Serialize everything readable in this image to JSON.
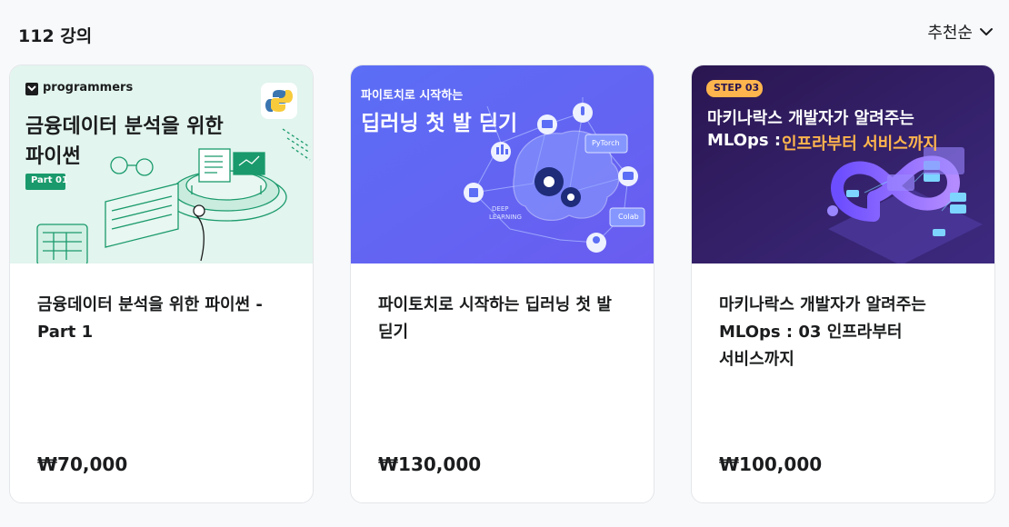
{
  "header": {
    "count_label": "112 강의",
    "sort_label": "추천순",
    "sort_icon": "chevron-down-icon"
  },
  "courses": [
    {
      "thumb": {
        "brand": "programmers",
        "headline_line1": "금융데이터 분석을 위한",
        "headline_line2": "파이썬",
        "badge": "Part 01",
        "bg": "#e2f5ee",
        "accent": "#1a9a6c",
        "logo_icon": "python-icon"
      },
      "title": "금융데이터 분석을 위한 파이썬 - Part 1",
      "price": "₩70,000"
    },
    {
      "thumb": {
        "subtitle": "파이토치로 시작하는",
        "headline": "딥러닝 첫 발 딛기",
        "bg": "#5b6ef5",
        "label_pytorch": "PyTorch",
        "label_colab": "Colab",
        "label_deep": "DEEP",
        "label_learning": "LEARNING"
      },
      "title": "파이토치로 시작하는 딥러닝 첫 발 딛기",
      "price": "₩130,000"
    },
    {
      "thumb": {
        "badge": "STEP 03",
        "headline_line1": "마키나락스 개발자가 알려주는",
        "headline_line2_a": "MLOps : ",
        "headline_line2_b": "인프라부터 서비스까지",
        "bg": "#2c1a55",
        "badge_color": "#ffb54d"
      },
      "title": "마키나락스 개발자가 알려주는 MLOps : 03 인프라부터 서비스까지",
      "price": "₩100,000"
    }
  ]
}
